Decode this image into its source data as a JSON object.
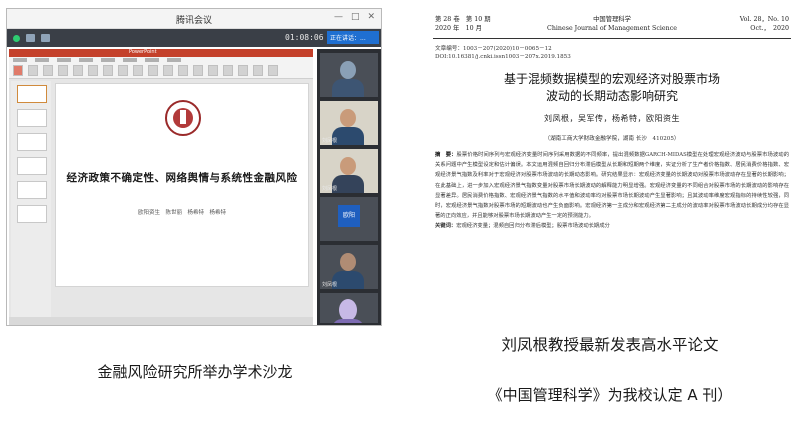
{
  "meeting": {
    "window_title": "腾讯会议",
    "timer": "01:08:06",
    "speaker_label": "正在讲话：...",
    "ppt_title": "PowerPoint",
    "slide": {
      "title": "经济政策不确定性、网络舆情与系统性金融风险",
      "authors": "欧阳资生　陈世丽　杨希特　杨希特"
    },
    "participants": [
      {
        "name": ""
      },
      {
        "name": "刘凤根"
      },
      {
        "name": "刘凤根"
      },
      {
        "name": "",
        "badge": "欧阳"
      },
      {
        "name": "刘凤根"
      },
      {
        "name": ""
      }
    ],
    "caption": "金融风险研究所举办学术沙龙"
  },
  "paper": {
    "header_left": [
      "第 28 卷　第 10 期",
      "2020 年　10 月"
    ],
    "header_center": [
      "中国管理科学",
      "Chinese Journal of Management Science"
    ],
    "header_right": [
      "Vol. 28，No. 10",
      "Oct.，　2020"
    ],
    "article_no": "文章编号：1003－207(2020)10－0065－12",
    "doi": "DOI:10.16381/j.cnki.issn1003－207x.2019.1853",
    "title_line1": "基于混频数据模型的宏观经济对股票市场",
    "title_line2": "波动的长期动态影响研究",
    "authors": "刘凤根，吴军传，杨希特，欧阳资生",
    "affiliation": "（湖南工商大学财政金融学院，湖南 长沙　410205）",
    "abstract_label": "摘　要：",
    "abstract": "股票价格时间序列与宏观经济变量时间序列采用数据的不同频率，提出混频数据GARCH-MIDAS模型在处理宏观经济波动与股票市场波动的关系问题中产生模型设定和估计偏误。本文运用混频自回归分布滞后模型从长期和短期两个维度，实证分析了生产者价格指数、居民消费价格指数、宏观经济景气指数及利率对于宏观经济对股票市场波动的长期动态影响。研究结果显示：宏观经济变量的长期波动对股票市场波动存在显著的长期影响；在此基础上，进一步加入宏观经济景气指数变量对股票市场长期波动的解释能力明显增强。宏观经济变量的不同组合对股票市场的长期波动的影响存在显著差异。居民消费价格指数、宏观经济景气指数的水平值和波动率均对股票市场长期波动产生显著影响；且其波动率维度宏观指标的持续性较强，同时，宏观经济景气指数对股票市场的短期波动也产生负面影响。宏观经济第一主成分和宏观经济第二主成分的波动率对股票市场波动长期成分均存在显著的正向效应，并且能够对股票市场长期波动产生一定的预测能力。",
    "keywords_label": "关键词：",
    "keywords": "宏观经济变量；混频自回归分布滞后模型；股票市场波动长期成分",
    "caption_line1": "刘凤根教授最新发表高水平论文",
    "caption_line2": "《中国管理科学》为我校认定 A 刊）"
  }
}
